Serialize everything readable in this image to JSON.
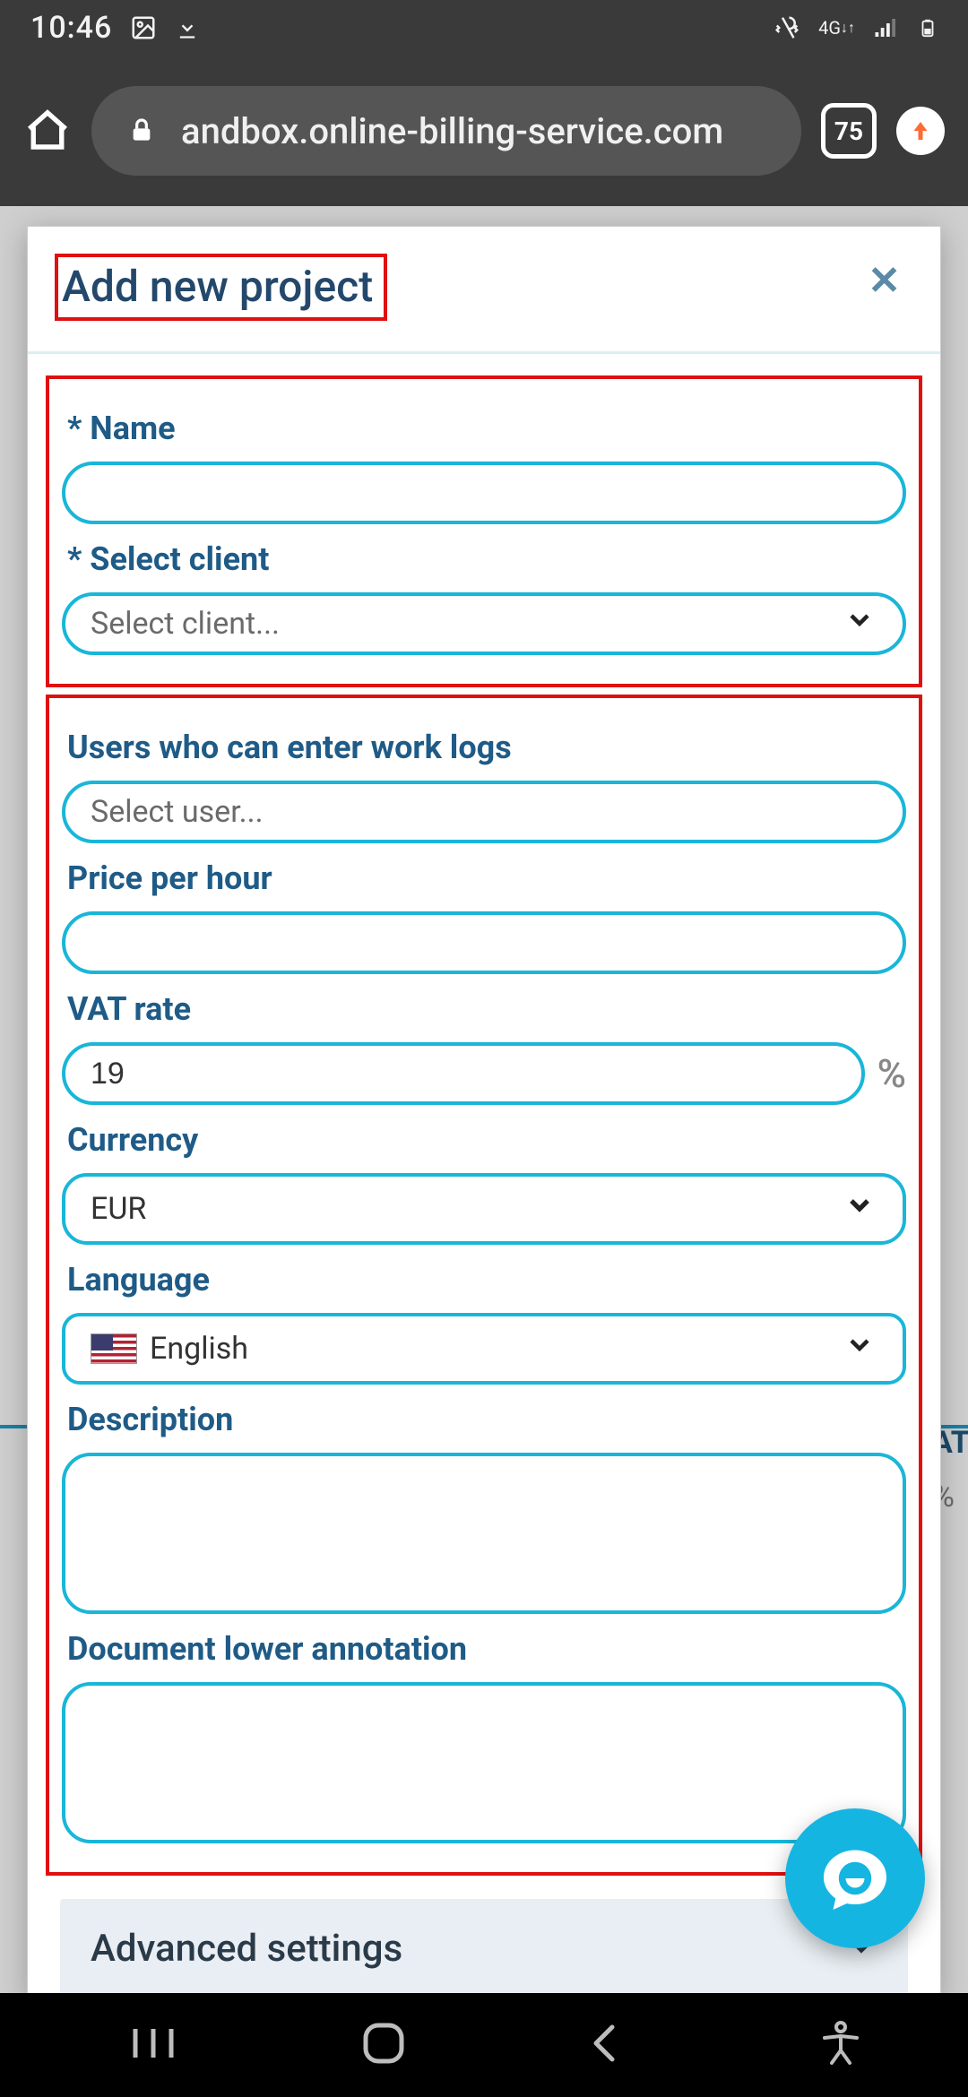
{
  "status": {
    "time": "10:46",
    "network_label": "4G",
    "tab_count": "75"
  },
  "browser": {
    "url": "andbox.online-billing-service.com"
  },
  "modal": {
    "title": "Add new project",
    "name_label": "Name",
    "name_value": "",
    "client_label": "Select client",
    "client_placeholder": "Select client...",
    "users_label": "Users who can enter work logs",
    "users_placeholder": "Select user...",
    "price_label": "Price per hour",
    "price_value": "",
    "vat_label": "VAT rate",
    "vat_value": "19",
    "vat_unit": "%",
    "currency_label": "Currency",
    "currency_value": "EUR",
    "language_label": "Language",
    "language_value": "English",
    "description_label": "Description",
    "description_value": "",
    "doc_annot_label": "Document lower annotation",
    "doc_annot_value": "",
    "advanced_label": "Advanced settings"
  },
  "bg": {
    "right_text1": "AT",
    "right_text2": "%"
  }
}
